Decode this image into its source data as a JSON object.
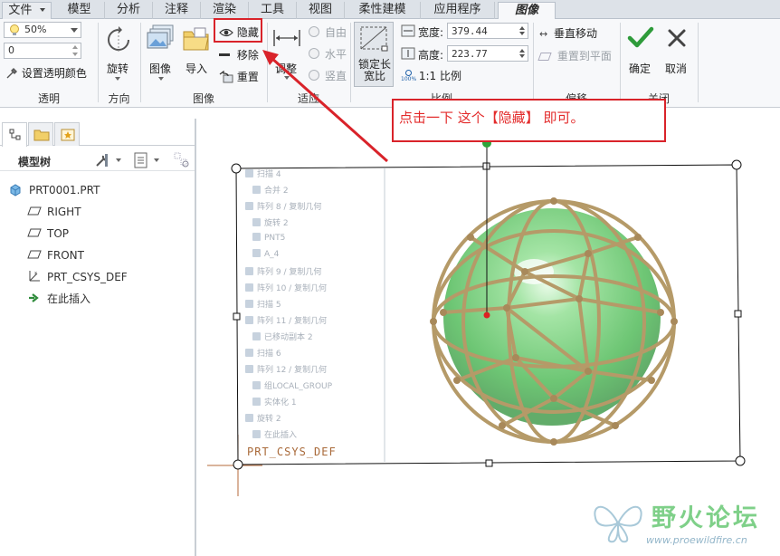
{
  "tabs": [
    {
      "label": "文件",
      "has_dropdown": true
    },
    {
      "label": "模型"
    },
    {
      "label": "分析"
    },
    {
      "label": "注释"
    },
    {
      "label": "渲染"
    },
    {
      "label": "工具"
    },
    {
      "label": "视图"
    },
    {
      "label": "柔性建模"
    },
    {
      "label": "应用程序"
    },
    {
      "label": "图像",
      "active": true
    }
  ],
  "ribbon": {
    "transparency": {
      "percent_value": "50%",
      "number_value": "0",
      "set_color_label": "设置透明颜色",
      "group_label": "透明"
    },
    "orientation": {
      "rotate_label": "旋转",
      "group_label": "方向"
    },
    "image": {
      "image_label": "图像",
      "import_label": "导入",
      "hide_label": "隐藏",
      "remove_label": "移除",
      "reset_label": "重置",
      "group_label": "图像"
    },
    "fit": {
      "adjust_label": "调整",
      "free_label": "自由",
      "horizontal_label": "水平",
      "vertical_label": "竖直",
      "group_label": "适应"
    },
    "scale": {
      "lock_ratio_label": "锁定长宽比",
      "width_label": "宽度:",
      "width_value": "379.44",
      "height_label": "高度:",
      "height_value": "223.77",
      "ratio_label": "1:1 比例",
      "ratio_icon": "100%",
      "group_label": "比例"
    },
    "offset": {
      "vertical_move_label": "垂直移动",
      "reset_to_plane_label": "重置到平面",
      "group_label": "偏移"
    },
    "close": {
      "ok_label": "确定",
      "cancel_label": "取消",
      "group_label": "关闭"
    }
  },
  "model_tree": {
    "header_label": "模型树",
    "items": [
      {
        "label": "PRT0001.PRT",
        "icon": "part-icon"
      },
      {
        "label": "RIGHT",
        "icon": "datum-plane-icon"
      },
      {
        "label": "TOP",
        "icon": "datum-plane-icon"
      },
      {
        "label": "FRONT",
        "icon": "datum-plane-icon"
      },
      {
        "label": "PRT_CSYS_DEF",
        "icon": "csys-icon"
      },
      {
        "label": "在此插入",
        "icon": "insert-arrow-icon"
      }
    ]
  },
  "background_image": {
    "ghost_items": [
      "扫描 4",
      "合并 2",
      "阵列 8 / 复制几何",
      "旋转 2",
      "PNT5",
      "A_4",
      "阵列 9 / 复制几何",
      "阵列 10 / 复制几何",
      "扫描 5",
      "阵列 11 / 复制几何",
      "已移动副本 2",
      "扫描 6",
      "阵列 12 / 复制几何",
      "组LOCAL_GROUP",
      "实体化 1",
      "旋转 2",
      "在此插入"
    ],
    "csys_label": "PRT_CSYS_DEF"
  },
  "annotation": {
    "text": "点击一下  这个【隐藏】    即可。",
    "color": "#e32b2b"
  },
  "watermark": {
    "title": "野火论坛",
    "url": "www.proewildfire.cn"
  },
  "colors": {
    "accent_red": "#d9232a",
    "sphere_green": "#7fcf83",
    "wire_tan": "#b59a68",
    "ok_green": "#2e9b3a"
  }
}
